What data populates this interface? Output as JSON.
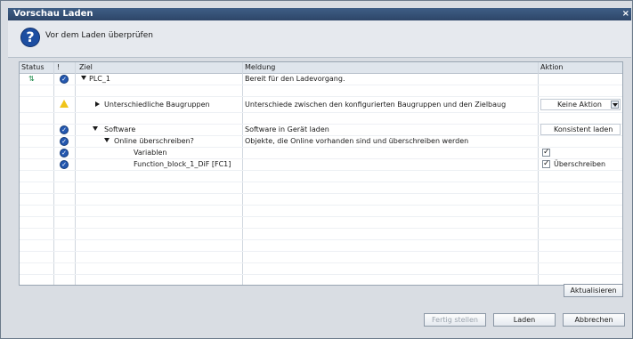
{
  "window": {
    "title": "Vorschau Laden",
    "close": "×"
  },
  "header": {
    "message": "Vor dem Laden überprüfen",
    "icon": "question-icon"
  },
  "columns": {
    "status": "Status",
    "bang": "!",
    "target": "Ziel",
    "message": "Meldung",
    "action": "Aktion"
  },
  "rows": [
    {
      "target": "PLC_1",
      "message": "Bereit für den Ladevorgang.",
      "status_icon": "plc-status-icon",
      "state_icon": "check-icon",
      "expanded": true
    },
    {
      "target": "Unterschiedliche Baugruppen",
      "message": "Unterschiede zwischen den konfigurierten Baugruppen und den Zielbaug",
      "state_icon": "warning-icon",
      "action": "Keine Aktion",
      "expanded": false
    },
    {
      "target": "Software",
      "message": "Software in Gerät laden",
      "state_icon": "check-icon",
      "action": "Konsistent laden",
      "expanded": true
    },
    {
      "target": "Online überschreiben?",
      "message": "Objekte, die Online vorhanden sind und überschreiben werden",
      "state_icon": "check-icon",
      "expanded": true
    },
    {
      "target": "Variablen",
      "message": "",
      "state_icon": "check-icon",
      "checkbox": true,
      "action_label": ""
    },
    {
      "target": "Function_block_1_DiF [FC1]",
      "message": "",
      "state_icon": "check-icon",
      "checkbox": true,
      "action_label": "Überschreiben"
    }
  ],
  "buttons": {
    "refresh": "Aktualisieren",
    "finish": "Fertig stellen",
    "load": "Laden",
    "cancel": "Abbrechen"
  }
}
